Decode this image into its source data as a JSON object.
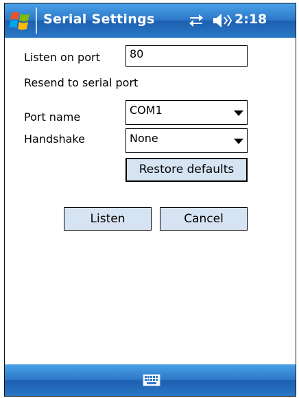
{
  "titlebar": {
    "title": "Serial Settings",
    "time": "2:18",
    "icons": [
      "windows-start-icon",
      "connectivity-icon",
      "volume-icon"
    ]
  },
  "form": {
    "listen_port_label": "Listen on port",
    "listen_port_value": "80",
    "resend_label": "Resend to serial port",
    "port_name_label": "Port name",
    "port_name_value": "COM1",
    "handshake_label": "Handshake",
    "handshake_value": "None",
    "restore_button": "Restore defaults"
  },
  "actions": {
    "listen_button": "Listen",
    "cancel_button": "Cancel"
  },
  "bottombar": {
    "icons": [
      "keyboard-icon"
    ]
  },
  "colors": {
    "titlebar_blue": "#2d78c8",
    "button_fill": "#d6e3f3"
  }
}
